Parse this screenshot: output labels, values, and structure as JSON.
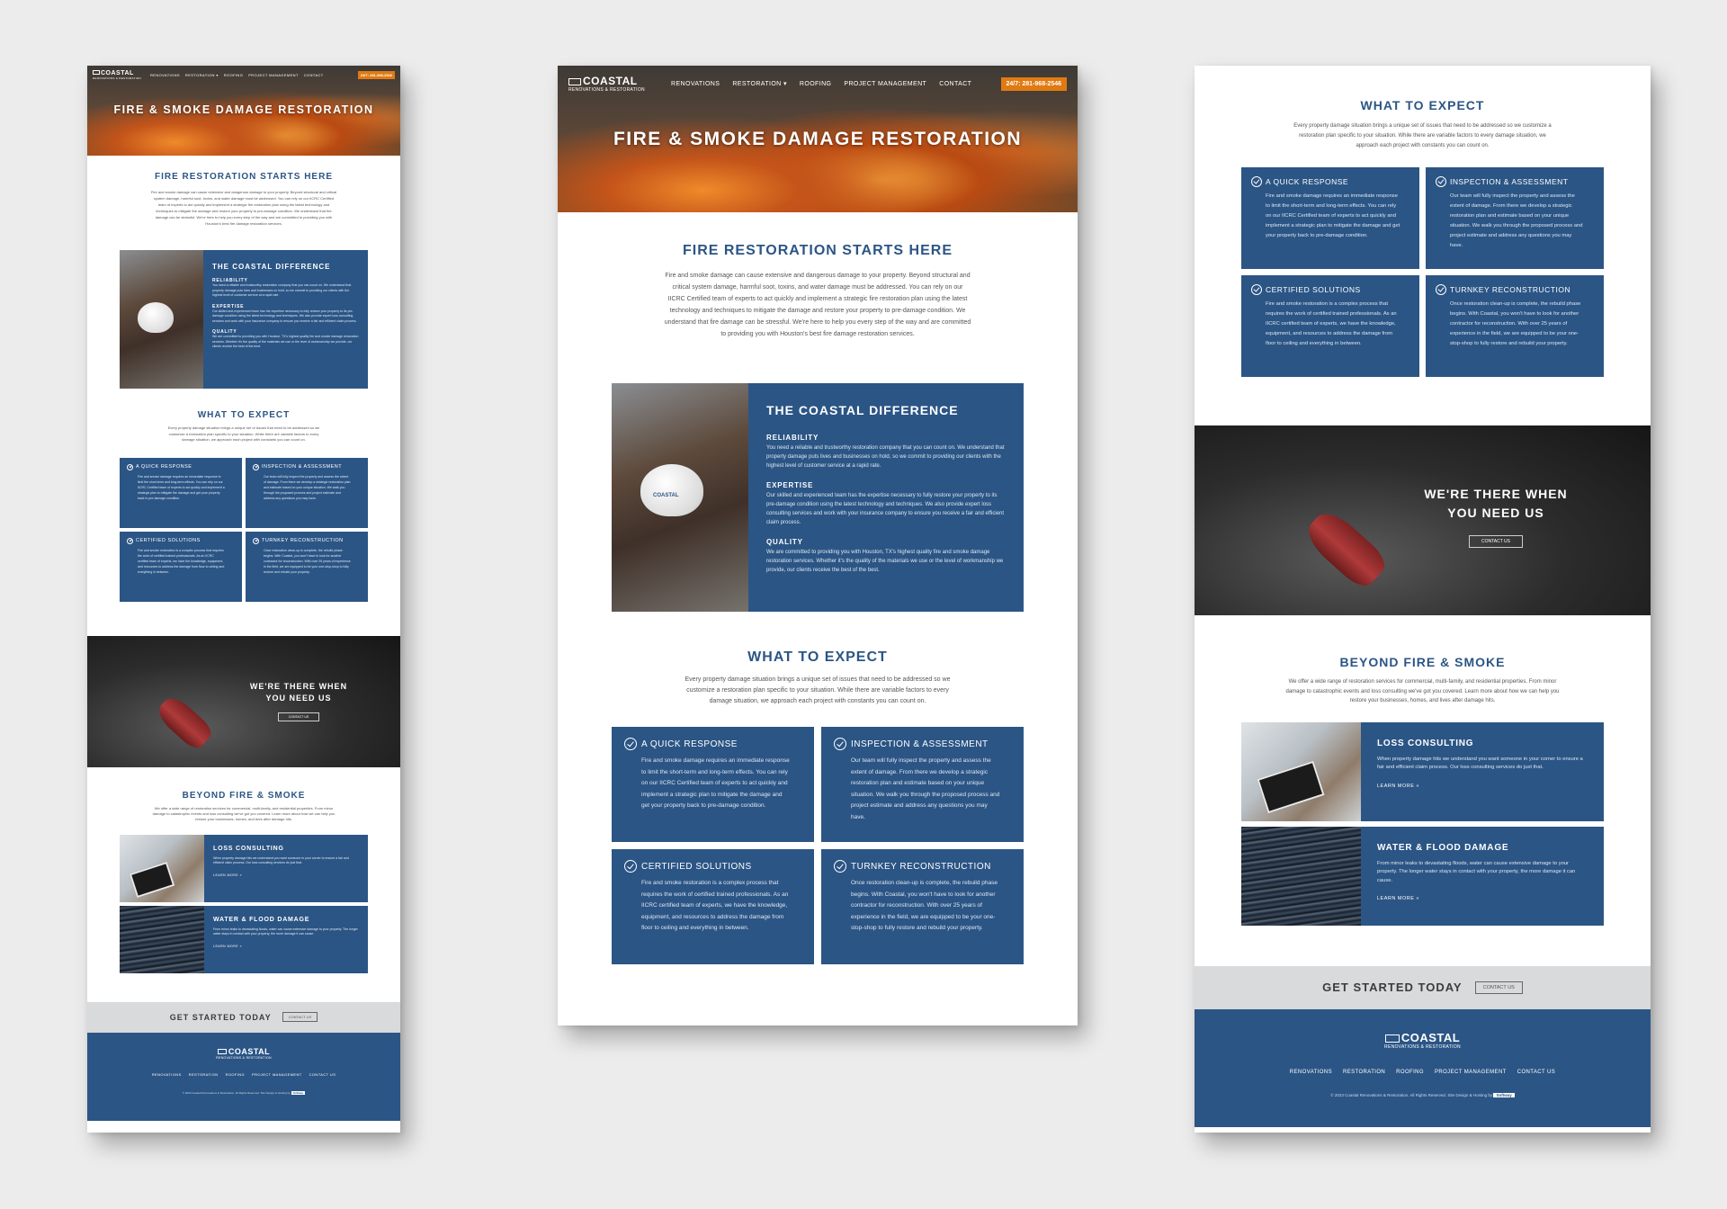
{
  "brand": {
    "name": "COASTAL",
    "tagline": "RENOVATIONS & RESTORATION",
    "colors": {
      "primary_blue": "#2b5585",
      "phone_orange": "#e07a12",
      "cta_gray": "#d9dadc"
    }
  },
  "nav": {
    "items": [
      "RENOVATIONS",
      "RESTORATION ▾",
      "ROOFING",
      "PROJECT MANAGEMENT",
      "CONTACT"
    ],
    "phone": "24/7: 281-968-2546"
  },
  "hero": {
    "title": "FIRE & SMOKE DAMAGE RESTORATION"
  },
  "intro": {
    "heading": "FIRE RESTORATION STARTS HERE",
    "body": "Fire and smoke damage can cause extensive and dangerous damage to your property. Beyond structural and critical system damage, harmful soot, toxins, and water damage must be addressed. You can rely on our IICRC Certified team of experts to act quickly and implement a strategic fire restoration plan using the latest technology and techniques to mitigate the damage and restore your property to pre-damage condition. We understand that fire damage can be stressful. We're here to help you every step of the way and are committed to providing you with Houston's best fire damage restoration services."
  },
  "difference": {
    "title": "THE COASTAL DIFFERENCE",
    "hardhat_text": "COASTAL",
    "items": [
      {
        "title": "RELIABILITY",
        "text": "You need a reliable and trustworthy restoration company that you can count on. We understand that property damage puts lives and businesses on hold, so we commit to providing our clients with the highest level of customer service at a rapid rate."
      },
      {
        "title": "EXPERTISE",
        "text": "Our skilled and experienced team has the expertise necessary to fully restore your property to its pre-damage condition using the latest technology and techniques. We also provide expert loss consulting services and work with your insurance company to ensure you receive a fair and efficient claim process."
      },
      {
        "title": "QUALITY",
        "text": "We are committed to providing you with Houston, TX's highest quality fire and smoke damage restoration services. Whether it's the quality of the materials we use or the level of workmanship we provide, our clients receive the best of the best."
      }
    ]
  },
  "expect": {
    "heading": "WHAT TO EXPECT",
    "body": "Every property damage situation brings a unique set of issues that need to be addressed so we customize a restoration plan specific to your situation. While there are variable factors to every damage situation, we approach each project with constants you can count on.",
    "cards": [
      {
        "title": "A QUICK RESPONSE",
        "text": "Fire and smoke damage requires an immediate response to limit the short-term and long-term effects. You can rely on our IICRC Certified team of experts to act quickly and implement a strategic plan to mitigate the damage and get your property back to pre-damage condition."
      },
      {
        "title": "INSPECTION & ASSESSMENT",
        "text": "Our team will fully inspect the property and assess the extent of damage. From there we develop a strategic restoration plan and estimate based on your unique situation. We walk you through the proposed process and project estimate and address any questions you may have."
      },
      {
        "title": "CERTIFIED SOLUTIONS",
        "text": "Fire and smoke restoration is a complex process that requires the work of certified trained professionals. As an IICRC certified team of experts, we have the knowledge, equipment, and resources to address the damage from floor to ceiling and everything in between."
      },
      {
        "title": "TURNKEY RECONSTRUCTION",
        "text": "Once restoration clean-up is complete, the rebuild phase begins. With Coastal, you won't have to look for another contractor for reconstruction. With over 25 years of experience in the field, we are equipped to be your one-stop-shop to fully restore and rebuild your property."
      }
    ]
  },
  "band": {
    "title": "WE'RE THERE WHEN YOU NEED US",
    "button": "CONTACT US"
  },
  "beyond": {
    "heading": "BEYOND FIRE & SMOKE",
    "body": "We offer a wide range of restoration services for commercial, multi-family, and residential properties. From minor damage to catastrophic events and loss consulting we've got you covered. Learn more about how we can help you restore your businesses, homes, and lives after damage hits.",
    "services": [
      {
        "title": "LOSS CONSULTING",
        "text": "When property damage hits we understand you want someone in your corner to ensure a fair and efficient claim process. Our loss consulting services do just that.",
        "link": "LEARN MORE »"
      },
      {
        "title": "WATER & FLOOD DAMAGE",
        "text": "From minor leaks to devastating floods, water can cause extensive damage to your property. The longer water stays in contact with your property, the more damage it can cause.",
        "link": "LEARN MORE »"
      }
    ]
  },
  "cta": {
    "text": "GET STARTED TODAY",
    "button": "CONTACT US"
  },
  "footer": {
    "links": [
      "RENOVATIONS",
      "RESTORATION",
      "ROOFING",
      "PROJECT MANAGEMENT",
      "CONTACT US"
    ],
    "copyright": "© 2023 Coastal Renovations & Restoration. All Rights Reserved. Site Design & Hosting by",
    "credit": "Softway"
  }
}
